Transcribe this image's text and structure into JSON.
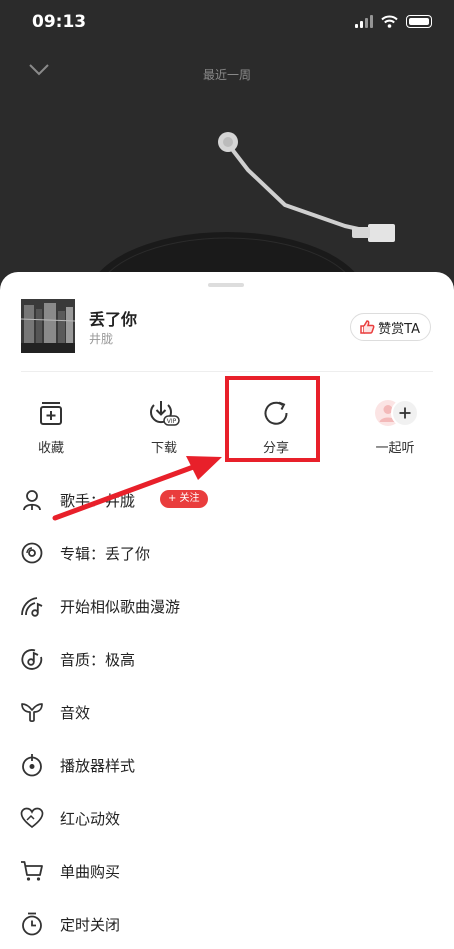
{
  "status_bar": {
    "time": "09:13"
  },
  "header": {
    "title": "最近一周"
  },
  "song": {
    "title": "丢了你",
    "artist": "井胧",
    "reward_label": "赞赏TA"
  },
  "actions": [
    {
      "label": "收藏",
      "icon": "collect-icon"
    },
    {
      "label": "下载",
      "icon": "download-icon"
    },
    {
      "label": "分享",
      "icon": "share-icon"
    },
    {
      "label": "一起听",
      "icon": "listen-together-icon"
    }
  ],
  "menu": [
    {
      "label": "歌手：井胧",
      "icon": "singer-icon",
      "badge": "+ 关注"
    },
    {
      "label": "专辑：丢了你",
      "icon": "album-icon"
    },
    {
      "label": "开始相似歌曲漫游",
      "icon": "roam-icon"
    },
    {
      "label": "音质：极高",
      "icon": "quality-icon"
    },
    {
      "label": "音效",
      "icon": "sound-effect-icon"
    },
    {
      "label": "播放器样式",
      "icon": "player-style-icon"
    },
    {
      "label": "红心动效",
      "icon": "heart-effect-icon"
    },
    {
      "label": "单曲购买",
      "icon": "cart-icon"
    },
    {
      "label": "定时关闭",
      "icon": "timer-icon"
    }
  ],
  "colors": {
    "accent": "#e93d3d",
    "highlight_box": "#e8202a",
    "arrow": "#e8202a"
  }
}
